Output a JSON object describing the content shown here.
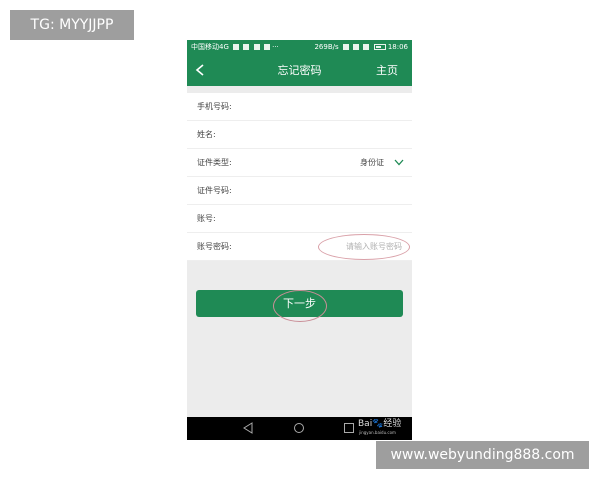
{
  "watermark": {
    "tg": "TG: MYYJJPP",
    "site": "www.webyunding888.com"
  },
  "status_bar": {
    "carrier": "中国移动4G",
    "dots": "···",
    "speed": "269B/s",
    "time": "18:06"
  },
  "header": {
    "back_icon": "chevron-left-icon",
    "title": "忘记密码",
    "home_label": "主页"
  },
  "form": {
    "rows": [
      {
        "label": "手机号码:",
        "value": "",
        "placeholder": ""
      },
      {
        "label": "姓名:",
        "value": "",
        "placeholder": ""
      },
      {
        "label": "证件类型:",
        "value": "身份证",
        "placeholder": ""
      },
      {
        "label": "证件号码:",
        "value": "",
        "placeholder": ""
      },
      {
        "label": "账号:",
        "value": "",
        "placeholder": ""
      },
      {
        "label": "账号密码:",
        "value": "",
        "placeholder": "请输入账号密码"
      }
    ]
  },
  "next_button": {
    "label": "下一步"
  },
  "nav_bar": {
    "icons": [
      "back-triangle-icon",
      "home-circle-icon",
      "recents-square-icon"
    ]
  },
  "brand": {
    "logo_text": "Bai🐾经验",
    "sub": "jingyan.baidu.com"
  },
  "colors": {
    "primary": "#1f8a55",
    "annotation": "#d9a0a8"
  }
}
